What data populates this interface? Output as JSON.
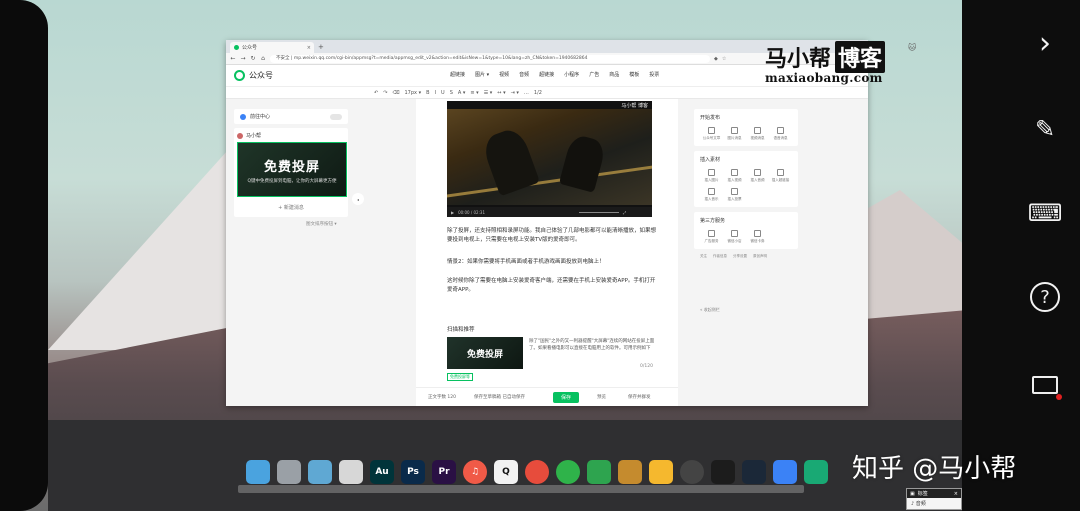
{
  "right_bar": {
    "icons": [
      "chevron-right-icon",
      "pen-icon",
      "keyboard-icon",
      "help-icon",
      "screen-record-icon"
    ],
    "help_glyph": "?"
  },
  "browser": {
    "tab_title": "公众号",
    "url": "不安全 | mp.weixin.qq.com/cgi-bin/appmsg?t=media/appmsg_edit_v2&action=edit&isNew=1&type=10&lang=zh_CN&token=1940682864"
  },
  "editor_page": {
    "app_name": "公众号",
    "insert_menu": [
      "超链接",
      "图片 ▾",
      "视频",
      "音频",
      "超链接",
      "小程序",
      "广告",
      "商品",
      "模板",
      "投票"
    ],
    "toolbar": [
      "↶",
      "↷",
      "⌫",
      "17px ▾",
      "B",
      "I",
      "U",
      "S",
      "A ▾",
      "≡ ▾",
      "☰ ▾",
      "↔ ▾",
      "⇥ ▾",
      "…",
      "1/2"
    ],
    "left_panel": {
      "notification": "前往中心",
      "account_name": "马小帮",
      "cover_title": "免费投屏",
      "cover_subtitle": "Q键中免费投屏到电脑，让你的大屏幕更方便",
      "add_article": "+ 新建消息",
      "sort_link": "图文排序按钮 ▾"
    },
    "video": {
      "watermark": "马小帮 博客",
      "time": "00:00 / 02:31"
    },
    "paragraphs": [
      "除了投屏，还支持照相和录屏功能。我自己体验了几部电影都可以能清晰播放，如果想要投到电视上，只需要在电视上安装TV版的爱奇即可。",
      "情景2：如果你需要将手机画面或者手机游戏画面投放到电脑上！",
      "这时候你除了需要在电脑上安装爱奇客户端，还需要在手机上安装爱奇APP。手机打开爱奇APP。"
    ],
    "recommend": {
      "label": "扫描和推荐",
      "thumb_title": "免费投屏",
      "desc": "除了\"国民\"之外的又一利器提醒\"大屏幕\"连续的网站在投屏上面了。如果看播电影可以直接在电脑用上的软件。可用示例如下",
      "count": "0/120",
      "tag": "免费投屏等"
    },
    "bottom_bar": {
      "wordcount": "正文字数 120",
      "autosave": "保存至草稿箱  已自动保存",
      "save": "保存",
      "preview": "预览",
      "publish": "保存并群发"
    },
    "right_panel": {
      "sections": [
        {
          "title": "开始发布",
          "items": [
            "公众号文章",
            "图片消息",
            "视频消息",
            "语音消息"
          ]
        },
        {
          "title": "插入素材",
          "items": [
            "插入图片",
            "插入视频",
            "插入音频",
            "插入超链接",
            "插入音乐",
            "插入投票"
          ]
        },
        {
          "title": "第三方服务",
          "items": [
            "广告服务",
            "微信小店",
            "微信卡券"
          ]
        }
      ],
      "links": [
        "关注",
        "作者信息",
        "分享设置",
        "原创声明"
      ],
      "collapse": "« 收起侧栏"
    }
  },
  "watermark": {
    "main": "马小帮",
    "blog": "博客",
    "url": "maxiaobang.com"
  },
  "dock": {
    "apps": [
      {
        "name": "monitor",
        "label": "",
        "color": "#4aa3df"
      },
      {
        "name": "trash",
        "label": "",
        "color": "#9aa0a6"
      },
      {
        "name": "finder",
        "label": "",
        "color": "#5fa8d3"
      },
      {
        "name": "rocket",
        "label": "",
        "color": "#d7d7d7"
      },
      {
        "name": "audition",
        "label": "Au",
        "color": "#00343a"
      },
      {
        "name": "photoshop",
        "label": "Ps",
        "color": "#0a2a4a"
      },
      {
        "name": "premiere",
        "label": "Pr",
        "color": "#2a1044"
      },
      {
        "name": "music",
        "label": "♫",
        "color": "#f05a47"
      },
      {
        "name": "qq",
        "label": "Q",
        "color": "#f2f2f2"
      },
      {
        "name": "chrome",
        "label": "",
        "color": "#e74c3c"
      },
      {
        "name": "wechat",
        "label": "",
        "color": "#2fb34a"
      },
      {
        "name": "messages",
        "label": "",
        "color": "#2ea44f"
      },
      {
        "name": "cat",
        "label": "",
        "color": "#c58b2e"
      },
      {
        "name": "shield",
        "label": "",
        "color": "#f5b82e"
      },
      {
        "name": "clock",
        "label": "",
        "color": "#444"
      },
      {
        "name": "refresh",
        "label": "",
        "color": "#1c1c1c"
      },
      {
        "name": "steam",
        "label": "",
        "color": "#1b2838"
      },
      {
        "name": "download",
        "label": "",
        "color": "#3b82f6"
      },
      {
        "name": "play",
        "label": "",
        "color": "#19a974"
      }
    ]
  },
  "zhihu_watermark": "知乎 @马小帮",
  "mini_window": {
    "title": "标签",
    "body": "♪ 音频"
  }
}
